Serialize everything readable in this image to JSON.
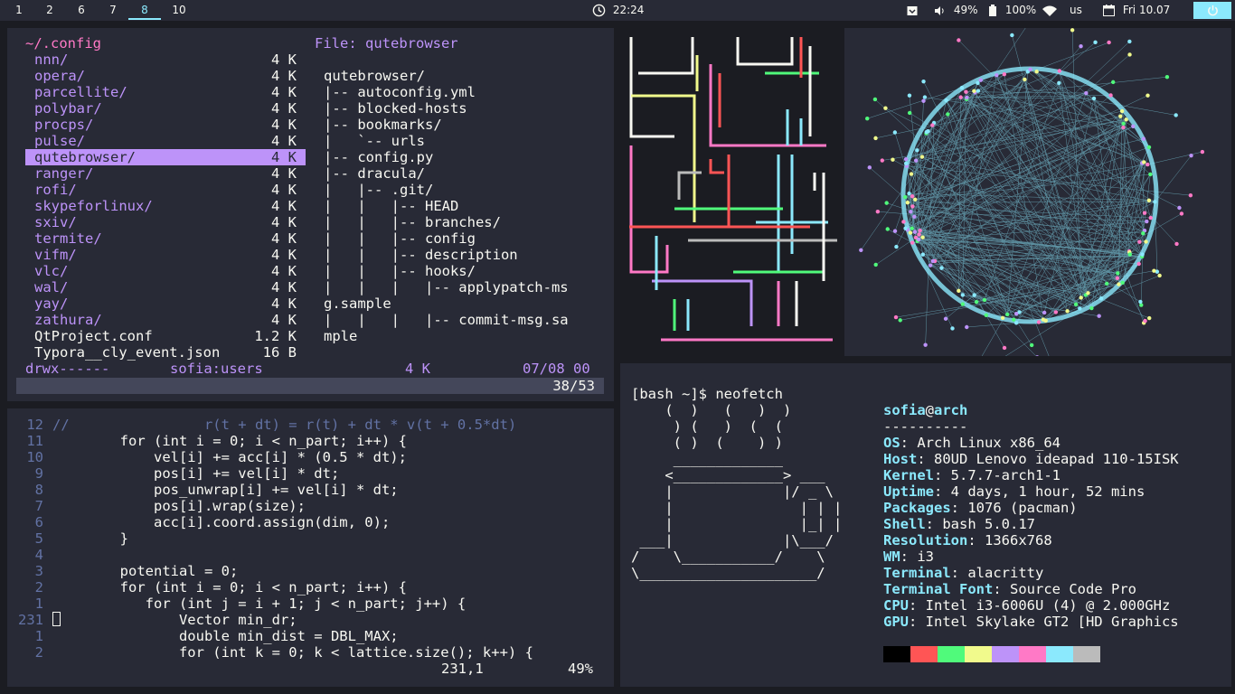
{
  "bar": {
    "workspaces": [
      "1",
      "2",
      "6",
      "7",
      "8",
      "10"
    ],
    "active_workspace": "8",
    "clock": "22:24",
    "volume": "49%",
    "battery": "100%",
    "layout": "us",
    "date": "Fri 10.07",
    "accent": "#8be9fd"
  },
  "nnn": {
    "path": "~/.config",
    "preview_title": "File: qutebrowser",
    "entries": [
      {
        "name": "nnn/",
        "size": "4 K"
      },
      {
        "name": "opera/",
        "size": "4 K"
      },
      {
        "name": "parcellite/",
        "size": "4 K"
      },
      {
        "name": "polybar/",
        "size": "4 K"
      },
      {
        "name": "procps/",
        "size": "4 K"
      },
      {
        "name": "pulse/",
        "size": "4 K"
      },
      {
        "name": "qutebrowser/",
        "size": "4 K"
      },
      {
        "name": "ranger/",
        "size": "4 K"
      },
      {
        "name": "rofi/",
        "size": "4 K"
      },
      {
        "name": "skypeforlinux/",
        "size": "4 K"
      },
      {
        "name": "sxiv/",
        "size": "4 K"
      },
      {
        "name": "termite/",
        "size": "4 K"
      },
      {
        "name": "vifm/",
        "size": "4 K"
      },
      {
        "name": "vlc/",
        "size": "4 K"
      },
      {
        "name": "wal/",
        "size": "4 K"
      },
      {
        "name": "yay/",
        "size": "4 K"
      },
      {
        "name": "zathura/",
        "size": "4 K"
      },
      {
        "name": "QtProject.conf",
        "size": "1.2 K"
      },
      {
        "name": "Typora__cly_event.json",
        "size": "16 B"
      }
    ],
    "selected_index": 6,
    "preview_lines": [
      "qutebrowser/",
      "|-- autoconfig.yml",
      "|-- blocked-hosts",
      "|-- bookmarks/",
      "|   `-- urls",
      "|-- config.py",
      "|-- dracula/",
      "|   |-- .git/",
      "|   |   |-- HEAD",
      "|   |   |-- branches/",
      "|   |   |-- config",
      "|   |   |-- description",
      "|   |   |-- hooks/",
      "|   |   |   |-- applypatch-ms",
      "g.sample",
      "|   |   |   |-- commit-msg.sa",
      "mple"
    ],
    "status_perms": "drwx------",
    "status_owner": "sofia:users",
    "status_size": "4 K",
    "status_date": "07/08 00",
    "counter": "38/53"
  },
  "vim": {
    "lines": [
      {
        "num": "12",
        "code": "//                r(t + dt) = r(t) + dt * v(t + 0.5*dt)"
      },
      {
        "num": "11",
        "code": "        for (int i = 0; i < n_part; i++) {"
      },
      {
        "num": "10",
        "code": "            vel[i] += acc[i] * (0.5 * dt);"
      },
      {
        "num": "9",
        "code": "            pos[i] += vel[i] * dt;"
      },
      {
        "num": "8",
        "code": "            pos_unwrap[i] += vel[i] * dt;"
      },
      {
        "num": "7",
        "code": "            pos[i].wrap(size);"
      },
      {
        "num": "6",
        "code": "            acc[i].coord.assign(dim, 0);"
      },
      {
        "num": "5",
        "code": "        }"
      },
      {
        "num": "4",
        "code": ""
      },
      {
        "num": "3",
        "code": "        potential = 0;"
      },
      {
        "num": "2",
        "code": "        for (int i = 0; i < n_part; i++) {"
      },
      {
        "num": "1",
        "code": "           for (int j = i + 1; j < n_part; j++) {"
      },
      {
        "num": "231",
        "code": "               Vector min_dr;"
      },
      {
        "num": "1",
        "code": "               double min_dist = DBL_MAX;"
      },
      {
        "num": "2",
        "code": "               for (int k = 0; k < lattice.size(); k++) {"
      }
    ],
    "ruler_pos": "231,1",
    "ruler_pct": "49%"
  },
  "neofetch": {
    "prompt": "[bash ~]$ neofetch",
    "ascii": [
      "    (  )   (   )  )",
      "     ) (   )  (  (",
      "     ( )  (    ) )",
      "     _____________",
      "    <_____________> ___",
      "    |             |/ _ \\",
      "    |               | | |",
      "    |               |_| |",
      " ___|             |\\___/",
      "/    \\___________/    \\",
      "\\_____________________/"
    ],
    "user": "sofia",
    "host": "arch",
    "separator": "----------",
    "info": [
      {
        "key": "OS",
        "value": "Arch Linux x86_64"
      },
      {
        "key": "Host",
        "value": "80UD Lenovo ideapad 110-15ISK"
      },
      {
        "key": "Kernel",
        "value": "5.7.7-arch1-1"
      },
      {
        "key": "Uptime",
        "value": "4 days, 1 hour, 52 mins"
      },
      {
        "key": "Packages",
        "value": "1076 (pacman)"
      },
      {
        "key": "Shell",
        "value": "bash 5.0.17"
      },
      {
        "key": "Resolution",
        "value": "1366x768"
      },
      {
        "key": "WM",
        "value": "i3"
      },
      {
        "key": "Terminal",
        "value": "alacritty"
      },
      {
        "key": "Terminal Font",
        "value": "Source Code Pro"
      },
      {
        "key": "CPU",
        "value": "Intel i3-6006U (4) @ 2.000GHz"
      },
      {
        "key": "GPU",
        "value": "Intel Skylake GT2 [HD Graphics"
      }
    ],
    "palette": [
      "#000000",
      "#ff5555",
      "#50fa7b",
      "#f1fa8c",
      "#bd93f9",
      "#ff79c6",
      "#8be9fd",
      "#bbbbbb"
    ]
  }
}
